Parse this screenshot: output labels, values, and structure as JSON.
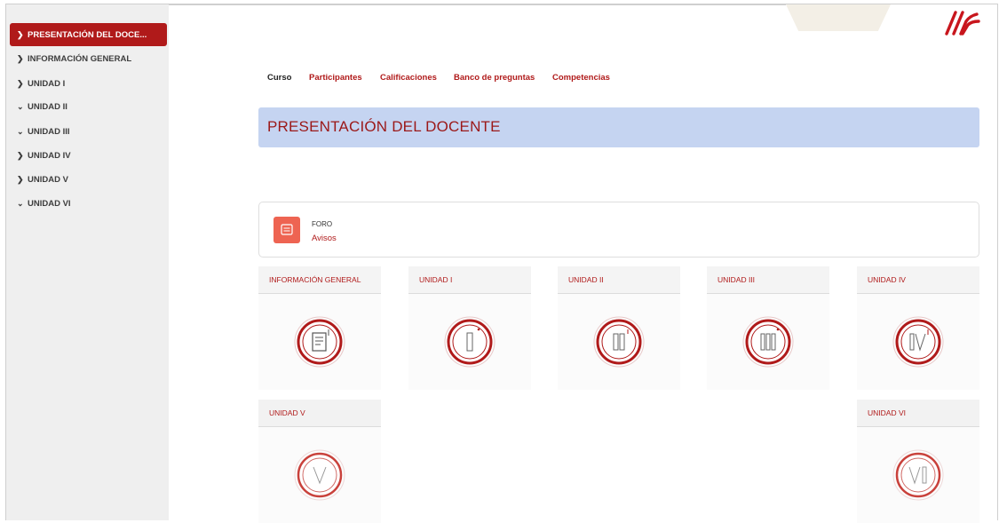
{
  "sidebar": {
    "items": [
      {
        "label": "PRESENTACIÓN DEL DOCE...",
        "chevron": ">",
        "active": true
      },
      {
        "label": "INFORMACIÓN GENERAL",
        "chevron": ">"
      },
      {
        "label": "UNIDAD I",
        "chevron": ">"
      },
      {
        "label": "UNIDAD II",
        "chevron": "v"
      },
      {
        "label": "UNIDAD III",
        "chevron": "v"
      },
      {
        "label": "UNIDAD IV",
        "chevron": ">"
      },
      {
        "label": "UNIDAD V",
        "chevron": ">"
      },
      {
        "label": "UNIDAD VI",
        "chevron": "v"
      }
    ]
  },
  "tabs": [
    {
      "label": "Curso",
      "active": true
    },
    {
      "label": "Participantes"
    },
    {
      "label": "Calificaciones"
    },
    {
      "label": "Banco de preguntas"
    },
    {
      "label": "Competencias"
    }
  ],
  "banner": {
    "title": "PRESENTACIÓN DEL DOCENTE"
  },
  "forum": {
    "type": "FORO",
    "link": "Avisos",
    "icon": "forum-icon"
  },
  "units": [
    {
      "label": "INFORMACIÓN GENERAL",
      "icon": "document-icon"
    },
    {
      "label": "UNIDAD I",
      "icon": "roman-1-icon"
    },
    {
      "label": "UNIDAD II",
      "icon": "roman-2-icon"
    },
    {
      "label": "UNIDAD III",
      "icon": "roman-3-icon"
    },
    {
      "label": "UNIDAD IV",
      "icon": "roman-4-icon"
    },
    {
      "label": "UNIDAD V",
      "icon": "roman-5-icon"
    },
    {
      "label": "UNIDAD VI",
      "icon": "roman-6-icon"
    }
  ],
  "colors": {
    "accent": "#b01a1a",
    "banner": "#c5d4f1",
    "forum_icon": "#ee6452"
  }
}
